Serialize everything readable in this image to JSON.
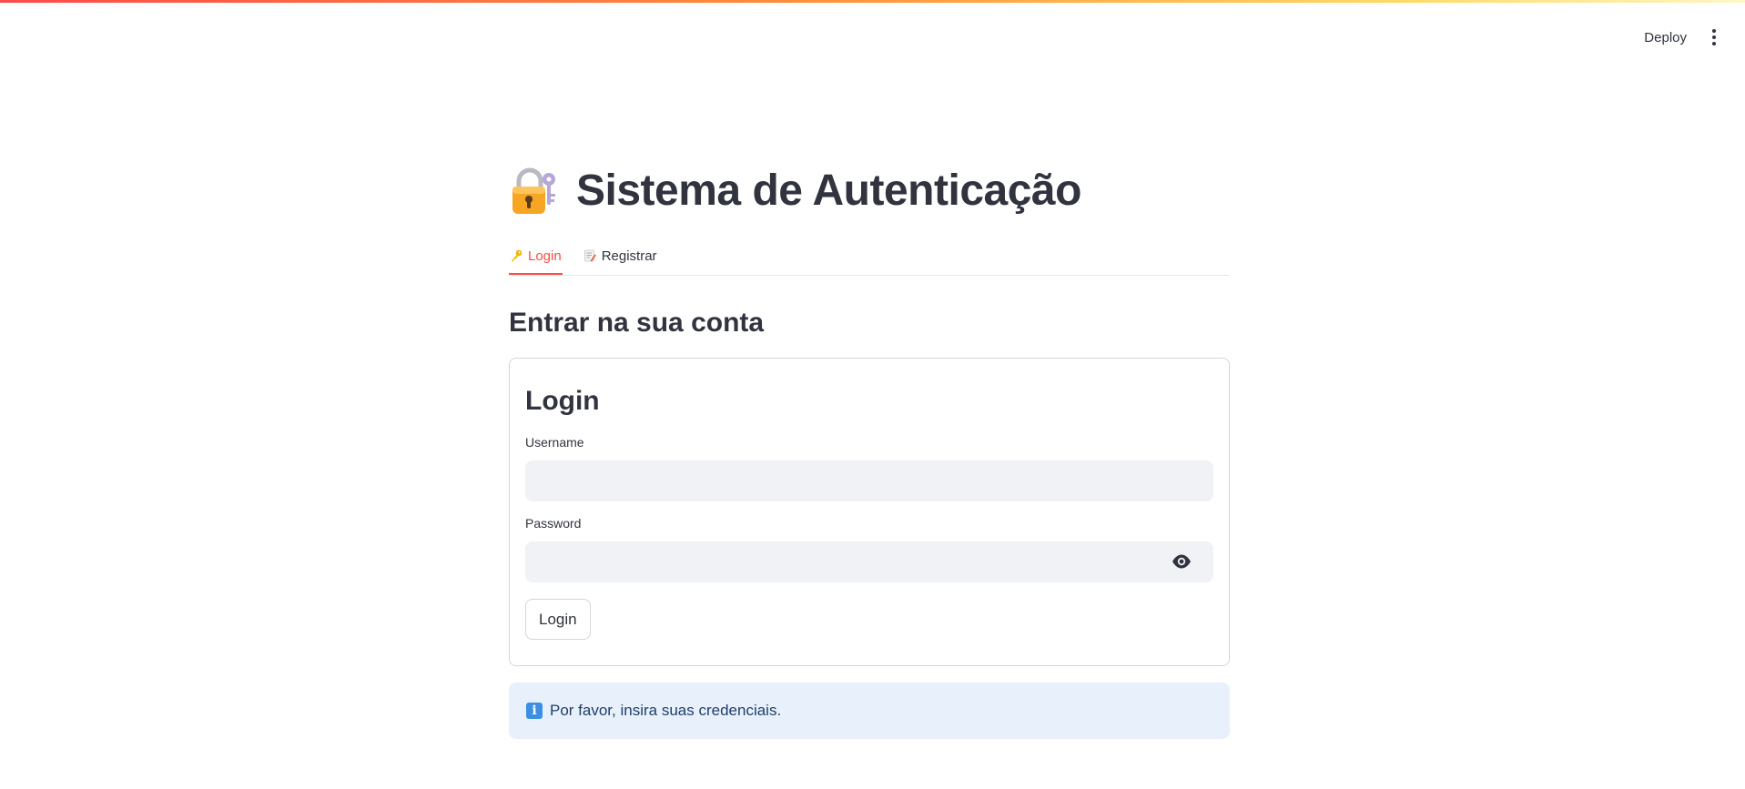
{
  "header": {
    "deploy_label": "Deploy",
    "menu_icon": "vertical-ellipsis-icon",
    "accent_gradient": [
      "#ff4b4b",
      "#ff8c3a",
      "#ffd966",
      "#fff6c4"
    ]
  },
  "page": {
    "title_icon": "locked-with-key-icon",
    "title": "Sistema de Autenticação"
  },
  "tabs": [
    {
      "label": "Login",
      "icon": "key-icon",
      "active": true
    },
    {
      "label": "Registrar",
      "icon": "memo-icon",
      "active": false
    }
  ],
  "section": {
    "heading": "Entrar na sua conta"
  },
  "form": {
    "title": "Login",
    "username_label": "Username",
    "username_value": "",
    "password_label": "Password",
    "password_value": "",
    "password_toggle_icon": "eye-icon",
    "submit_label": "Login"
  },
  "info": {
    "icon": "information-icon",
    "message": "Por favor, insira suas credenciais."
  },
  "colors": {
    "accent": "#ff4b4b",
    "text": "#31333f",
    "input_bg": "#f0f2f6",
    "info_bg": "#e8f1fb",
    "info_text": "#1d3f6b"
  }
}
